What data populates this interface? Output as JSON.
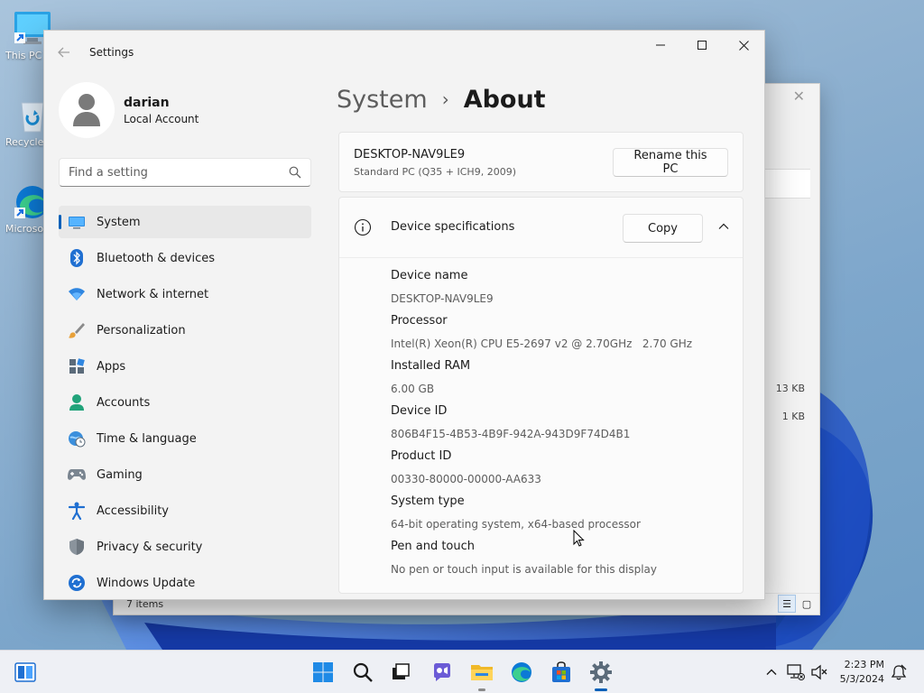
{
  "desktop": {
    "icons": [
      {
        "label": "This PC Shortcut",
        "icon": "monitor-icon"
      },
      {
        "label": "Recycle Bin",
        "icon": "recycle-bin-icon"
      },
      {
        "label": "Microsoft Edge",
        "icon": "edge-icon"
      }
    ]
  },
  "explorer": {
    "status": "7 items",
    "file_sizes": [
      "13 KB",
      "1 KB"
    ]
  },
  "window": {
    "title": "Settings"
  },
  "profile": {
    "name": "darian",
    "account_type": "Local Account"
  },
  "search": {
    "placeholder": "Find a setting"
  },
  "nav": [
    {
      "label": "System",
      "icon": "system-display-icon",
      "active": true
    },
    {
      "label": "Bluetooth & devices",
      "icon": "bluetooth-icon"
    },
    {
      "label": "Network & internet",
      "icon": "wifi-icon"
    },
    {
      "label": "Personalization",
      "icon": "brush-icon"
    },
    {
      "label": "Apps",
      "icon": "apps-icon"
    },
    {
      "label": "Accounts",
      "icon": "person-icon"
    },
    {
      "label": "Time & language",
      "icon": "globe-clock-icon"
    },
    {
      "label": "Gaming",
      "icon": "gamepad-icon"
    },
    {
      "label": "Accessibility",
      "icon": "accessibility-icon"
    },
    {
      "label": "Privacy & security",
      "icon": "shield-icon"
    },
    {
      "label": "Windows Update",
      "icon": "update-icon"
    }
  ],
  "breadcrumb": {
    "parent": "System",
    "separator": "›",
    "current": "About"
  },
  "pc": {
    "name": "DESKTOP-NAV9LE9",
    "model": "Standard PC (Q35 + ICH9, 2009)",
    "rename_label": "Rename this PC"
  },
  "specs": {
    "title": "Device specifications",
    "copy_label": "Copy",
    "rows": [
      {
        "label": "Device name",
        "value": "DESKTOP-NAV9LE9"
      },
      {
        "label": "Processor",
        "value": "Intel(R) Xeon(R) CPU E5-2697 v2 @ 2.70GHz   2.70 GHz"
      },
      {
        "label": "Installed RAM",
        "value": "6.00 GB"
      },
      {
        "label": "Device ID",
        "value": "806B4F15-4B53-4B9F-942A-943D9F74D4B1"
      },
      {
        "label": "Product ID",
        "value": "00330-80000-00000-AA633"
      },
      {
        "label": "System type",
        "value": "64-bit operating system, x64-based processor"
      },
      {
        "label": "Pen and touch",
        "value": "No pen or touch input is available for this display"
      }
    ]
  },
  "taskbar": {
    "clock_time": "2:23 PM",
    "clock_date": "5/3/2024",
    "accent": "#005fb8"
  }
}
